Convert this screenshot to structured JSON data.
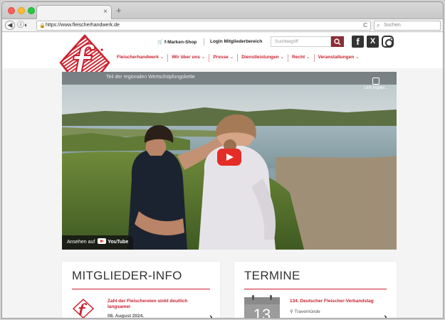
{
  "browser": {
    "tab_title": "",
    "close_glyph": "×",
    "newtab_glyph": "+",
    "url": "https://www.fleischerhandwerk.de",
    "search_placeholder": "Suchen",
    "lock_icon": "lock-icon"
  },
  "header": {
    "shop_link": "f-Marken-Shop",
    "login_link": "Login Mitgliederbereich",
    "search_placeholder": "Suchbegriff",
    "social": {
      "facebook": "f",
      "x": "X"
    }
  },
  "nav": [
    {
      "label": "Fleischerhandwerk"
    },
    {
      "label": "Wir über uns"
    },
    {
      "label": "Presse"
    },
    {
      "label": "Dienstleistungen"
    },
    {
      "label": "Recht"
    },
    {
      "label": "Veranstaltungen"
    }
  ],
  "video": {
    "title": "Teil der regionalen Wertschöpfungskette",
    "link_copy": "Link kopier...",
    "watch_on": "Ansehen auf",
    "yt_word": "YouTube"
  },
  "members": {
    "heading": "MITGLIEDER-INFO",
    "item": {
      "title": "Zahl der Fleischereien sinkt deutlich langsamer",
      "date": "08. August 2024."
    }
  },
  "events": {
    "heading": "TERMINE",
    "item": {
      "day": "13",
      "title": "134. Deutscher Fleischer-Verbandstag",
      "place": "Travemünde"
    }
  },
  "colors": {
    "brand_red": "#c8202d",
    "search_button": "#8c2d35"
  }
}
